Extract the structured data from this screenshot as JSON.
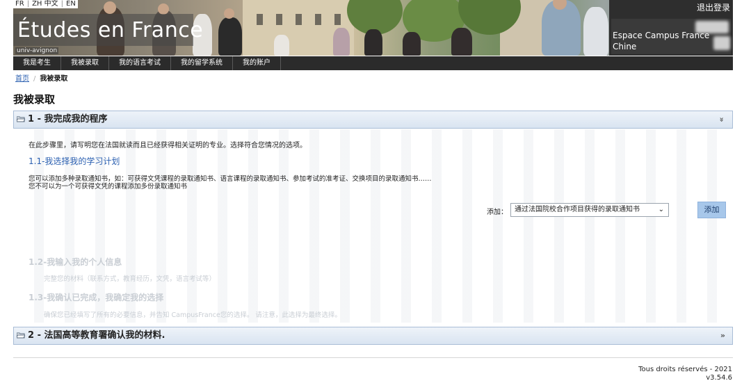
{
  "header": {
    "languages": [
      "FR",
      "ZH 中文",
      "EN"
    ],
    "logo_text": "Études en France",
    "university": "univ-avignon",
    "logout_label": "退出登录",
    "campus_label": "Espace Campus France Chine",
    "campus_line2": "C"
  },
  "nav": {
    "items": [
      "我是考生",
      "我被录取",
      "我的语言考试",
      "我的留学系统",
      "我的账户"
    ]
  },
  "breadcrumb": {
    "home": "首页",
    "current": "我被录取"
  },
  "page_title": "我被录取",
  "section1": {
    "title": "1 - 我完成我的程序",
    "toggle": "»",
    "intro": "在此步骤里，请写明您在法国就读而且已经获得相关证明的专业。选择符合您情况的选项。",
    "sub1_title": "1.1-我选择我的学习计划",
    "sub1_desc1": "您可以添加多种录取通知书，如：可获得文凭课程的录取通知书、语言课程的录取通知书、参加考试的准考证、交换项目的录取通知书……",
    "sub1_desc2": "您不可以为一个可获得文凭的课程添加多份录取通知书",
    "add_label": "添加：",
    "add_select_value": "通过法国院校合作项目获得的录取通知书",
    "add_button": "添加",
    "sub2_title": "1.2-我输入我的个人信息",
    "sub2_desc": "完整您的材料（联系方式，教育经历，文凭，语言考试等）",
    "sub3_title": "1.3-我确认已完成，我确定我的选择",
    "sub3_desc": "确保您已经填写了所有的必要信息，并告知 CampusFrance您的选择。 请注意，此选择为最终选择。"
  },
  "section2": {
    "title": "2 - 法国高等教育署确认我的材料.",
    "toggle": "»"
  },
  "footer": {
    "rights": "Tous droits réservés - 2021",
    "version": "v3.54.6"
  },
  "colors": {
    "nav_bg": "#2b2b2b",
    "section_border": "#a9bdd6",
    "link": "#2a5fb0",
    "button_bg": "#a7c7ea"
  }
}
